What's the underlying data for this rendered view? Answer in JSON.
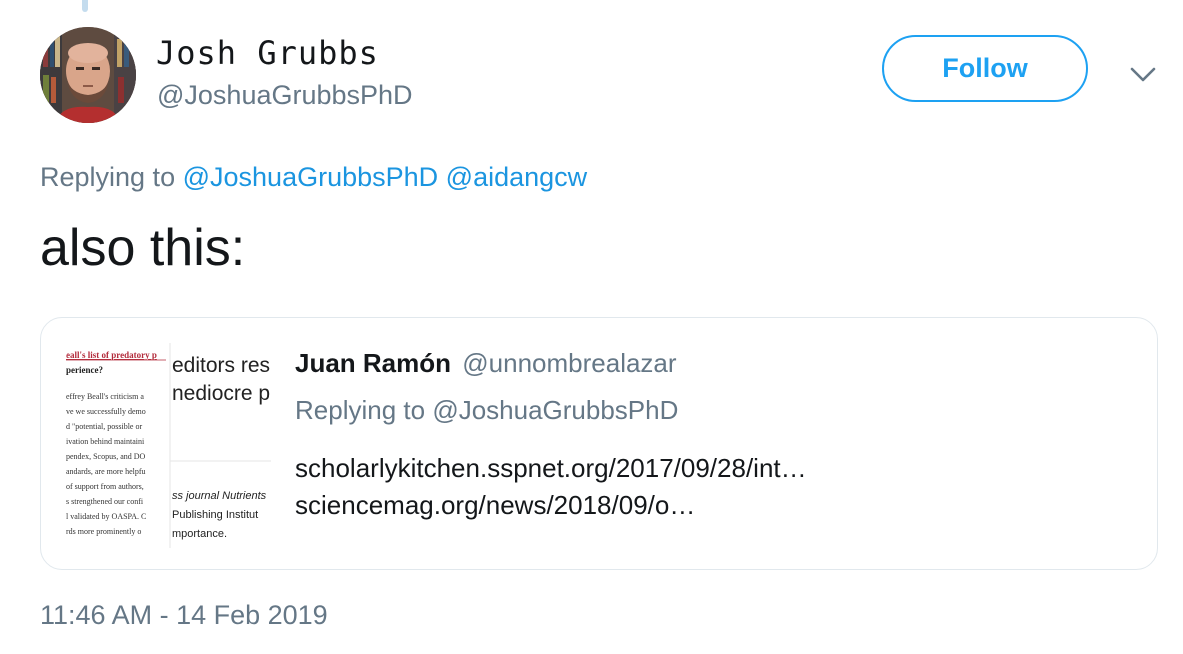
{
  "author": {
    "display_name": "Josh Grubbs",
    "handle": "@JoshuaGrubbsPhD"
  },
  "actions": {
    "follow_label": "Follow",
    "more_icon": "chevron-down-icon"
  },
  "reply_context": {
    "prefix": "Replying to",
    "mentions": [
      "@JoshuaGrubbsPhD",
      "@aidangcw"
    ]
  },
  "tweet": {
    "text": "also this:",
    "timestamp": "11:46 AM - 14 Feb 2019"
  },
  "quoted_tweet": {
    "author_name": "Juan Ramón",
    "author_handle": "@unnombrealazar",
    "reply_prefix": "Replying to",
    "reply_mention": "@JoshuaGrubbsPhD",
    "links": [
      "scholarlykitchen.sspnet.org/2017/09/28/int…",
      "sciencemag.org/news/2018/09/o…"
    ],
    "thumbnail": {
      "headline": "eall's list of predatory p",
      "subheading": "perience?",
      "body_lines": [
        "effrey Beall's criticism a",
        "ve we successfully demo",
        "d \"potential, possible or",
        "ivation behind maintaini",
        "pendex, Scopus, and DO",
        "andards, are more helpfu",
        " of support from authors,",
        "s strengthened our confi",
        "l validated by OASPA. C",
        "rds more prominently o"
      ],
      "overlay_lines": [
        "editors res",
        "nediocre pa"
      ],
      "footer_lines": [
        "ss journal Nutrients",
        "Publishing Institut",
        "mportance."
      ]
    }
  },
  "colors": {
    "accent": "#1da1f2",
    "link": "#1b95e0",
    "secondary_text": "#657786",
    "border": "#e1e8ed"
  }
}
